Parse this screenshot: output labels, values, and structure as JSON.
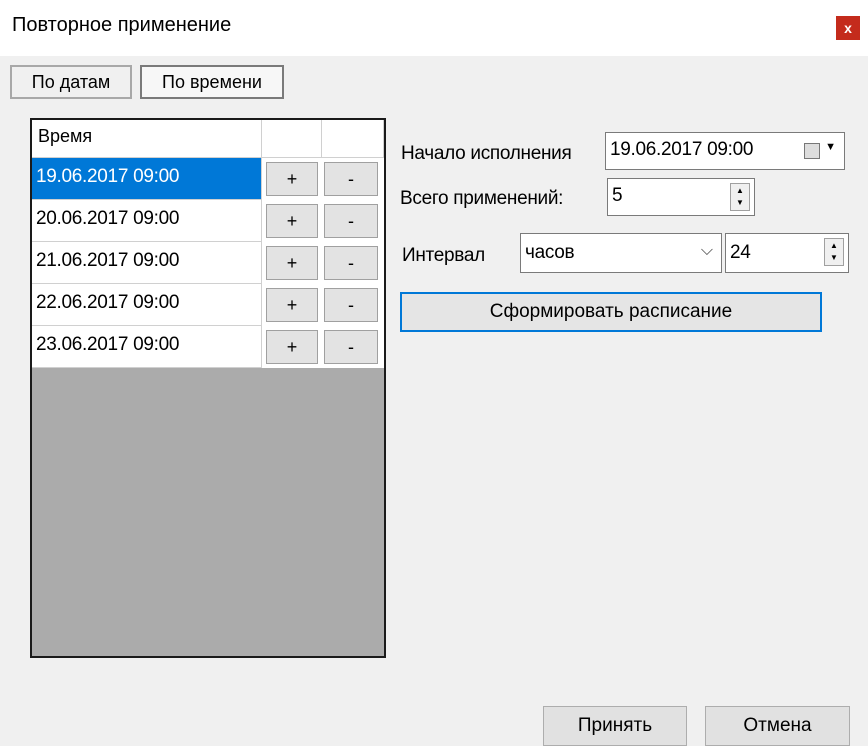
{
  "window": {
    "title": "Повторное применение",
    "close_glyph": "x"
  },
  "tabs": [
    {
      "label": "По датам"
    },
    {
      "label": "По времени"
    }
  ],
  "grid": {
    "header": {
      "time": "Время"
    },
    "rows": [
      {
        "time": "19.06.2017 09:00",
        "plus": "+",
        "minus": "-",
        "selected": true
      },
      {
        "time": "20.06.2017 09:00",
        "plus": "+",
        "minus": "-"
      },
      {
        "time": "21.06.2017 09:00",
        "plus": "+",
        "minus": "-"
      },
      {
        "time": "22.06.2017 09:00",
        "plus": "+",
        "minus": "-"
      },
      {
        "time": "23.06.2017 09:00",
        "plus": "+",
        "minus": "-"
      }
    ]
  },
  "form": {
    "start_label": "Начало исполнения",
    "start_value": "19.06.2017 09:00",
    "count_label": "Всего применений:",
    "count_value": "5",
    "interval_label": "Интервал",
    "interval_unit": "часов",
    "interval_value": "24",
    "generate_label": "Сформировать расписание"
  },
  "footer": {
    "ok_label": "Принять",
    "cancel_label": "Отмена"
  },
  "colors": {
    "selection": "#0078d7",
    "close": "#c42b1c",
    "grid_bg": "#ababab"
  }
}
